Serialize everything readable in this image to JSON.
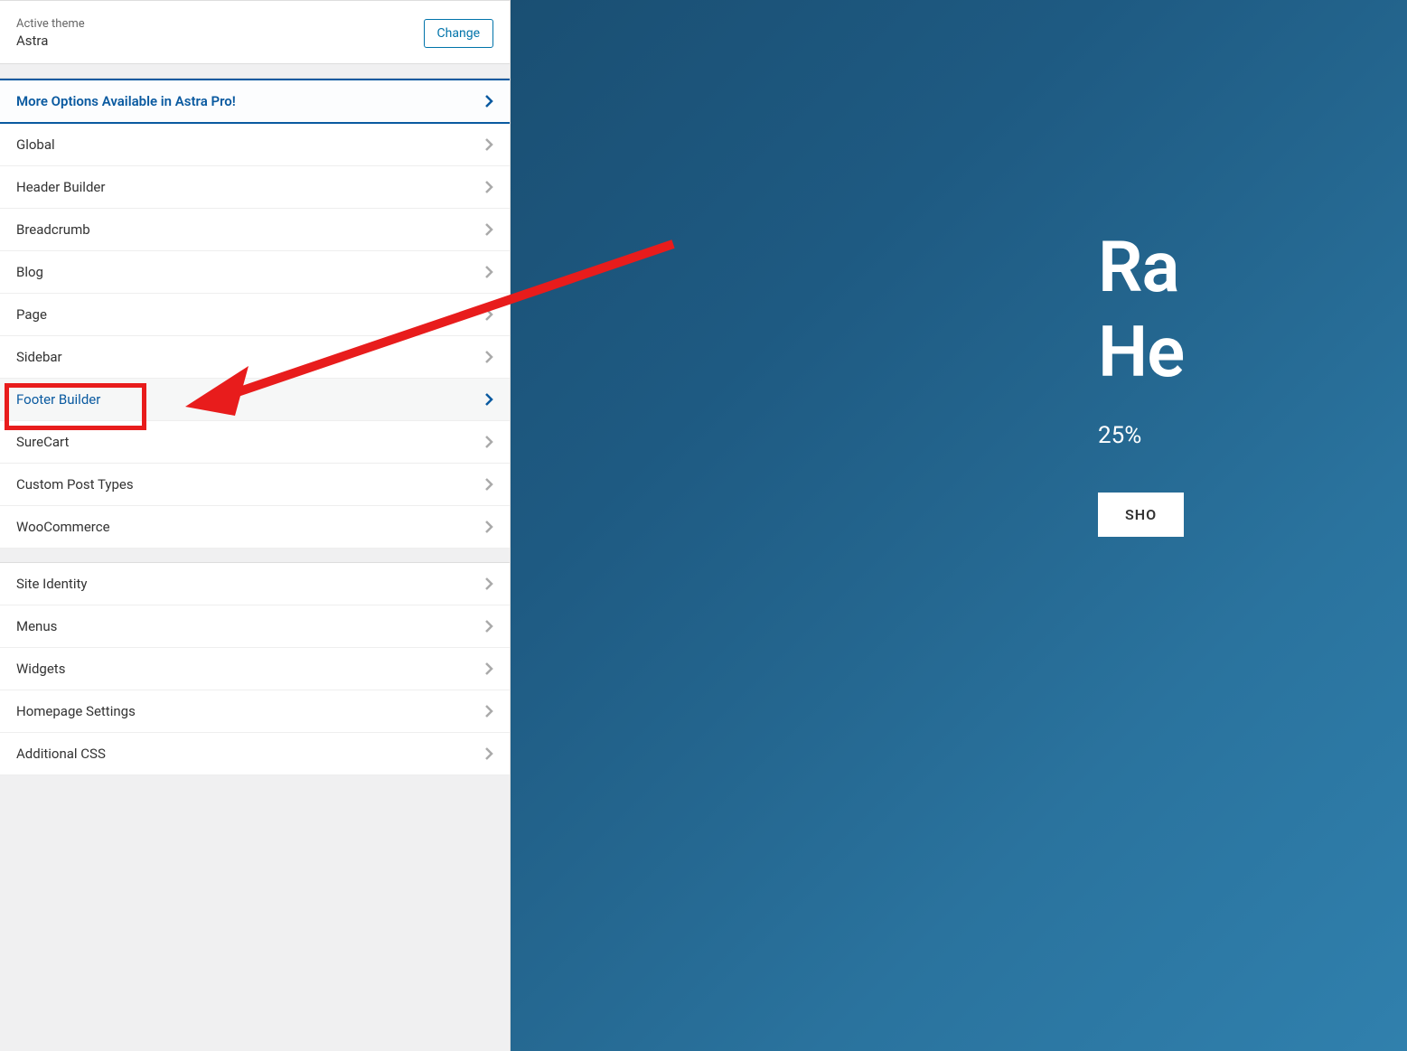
{
  "theme": {
    "label": "Active theme",
    "name": "Astra",
    "change_btn": "Change"
  },
  "menu_groups": [
    {
      "items": [
        {
          "label": "More Options Available in Astra Pro!",
          "style": "pro"
        },
        {
          "label": "Global"
        },
        {
          "label": "Header Builder"
        },
        {
          "label": "Breadcrumb"
        },
        {
          "label": "Blog"
        },
        {
          "label": "Page"
        },
        {
          "label": "Sidebar"
        },
        {
          "label": "Footer Builder",
          "style": "highlighted"
        },
        {
          "label": "SureCart"
        },
        {
          "label": "Custom Post Types"
        },
        {
          "label": "WooCommerce"
        }
      ]
    },
    {
      "items": [
        {
          "label": "Site Identity"
        },
        {
          "label": "Menus"
        },
        {
          "label": "Widgets"
        },
        {
          "label": "Homepage Settings"
        },
        {
          "label": "Additional CSS"
        }
      ]
    }
  ],
  "preview": {
    "title_line1": "Ra",
    "title_line2": "He",
    "subtitle": "25%",
    "cta": "SHO"
  }
}
